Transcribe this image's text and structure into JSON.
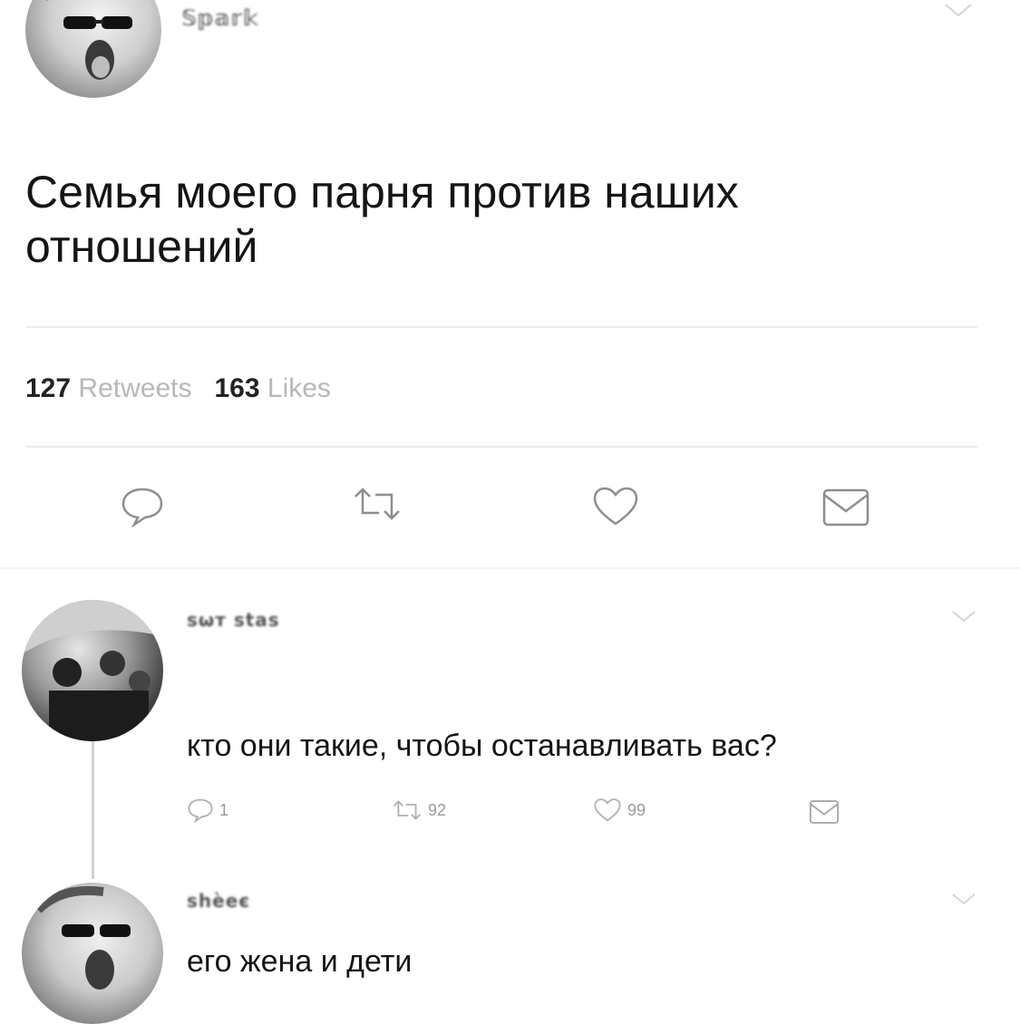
{
  "main_tweet": {
    "author_handle": "𝕊𝕡𝕒𝕣𝕜",
    "text": "Семья моего парня против наших отношений",
    "retweet_count": "127",
    "retweet_label": "Retweets",
    "like_count": "163",
    "like_label": "Likes",
    "actions": [
      "reply-icon",
      "retweet-icon",
      "like-icon",
      "message-icon"
    ]
  },
  "replies": [
    {
      "author_handle": "ѕѡт ѕtаѕ",
      "text": "кто они такие, чтобы останавливать вас?",
      "reply_count": "1",
      "retweet_count": "92",
      "like_count": "99"
    },
    {
      "author_handle": "ѕhѐеє",
      "text": "его жена и дети"
    }
  ]
}
